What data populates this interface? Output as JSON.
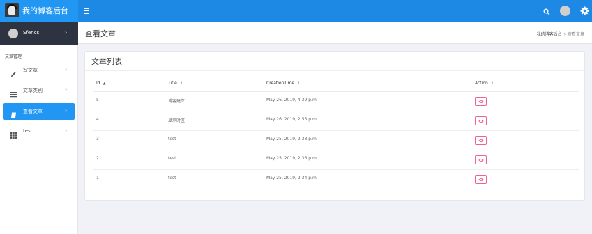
{
  "brand": {
    "title": "我的博客后台"
  },
  "icons": {
    "menu": "hamburger-menu-icon",
    "search": "search-icon",
    "settings": "gear-icon",
    "view": "eye-icon"
  },
  "colors": {
    "primary": "#2196f3",
    "topbar": "#1e88e5",
    "sidebar_user_bg": "#2d3340",
    "view_button": "#f06292"
  },
  "user": {
    "name": "Sfencs"
  },
  "sidebar": {
    "section_label": "文章管理",
    "items": [
      {
        "label": "写文章",
        "icon": "pencil-icon",
        "active": false
      },
      {
        "label": "文章类别",
        "icon": "list-icon",
        "active": false
      },
      {
        "label": "查看文章",
        "icon": "book-icon",
        "active": true
      },
      {
        "label": "test",
        "icon": "grid-icon",
        "active": false
      }
    ]
  },
  "page": {
    "title": "查看文章",
    "breadcrumb": {
      "home": "我的博客后台",
      "separator": "›",
      "current": "查看文章"
    }
  },
  "card": {
    "title": "文章列表"
  },
  "table": {
    "columns": [
      {
        "label": "Id",
        "sort": "▲"
      },
      {
        "label": "Title",
        "sort": "⇕"
      },
      {
        "label": "CreationTime",
        "sort": "⇕"
      },
      {
        "label": "Action",
        "sort": "⇕"
      }
    ],
    "rows": [
      {
        "id": "5",
        "title": "博客建立",
        "time": "May 26, 2019, 4:39 p.m."
      },
      {
        "id": "4",
        "title": "显示时区",
        "time": "May 26, 2019, 2:55 p.m."
      },
      {
        "id": "3",
        "title": "test",
        "time": "May 25, 2019, 2:38 p.m."
      },
      {
        "id": "2",
        "title": "test",
        "time": "May 25, 2019, 2:36 p.m."
      },
      {
        "id": "1",
        "title": "test",
        "time": "May 25, 2019, 2:34 p.m."
      }
    ]
  }
}
